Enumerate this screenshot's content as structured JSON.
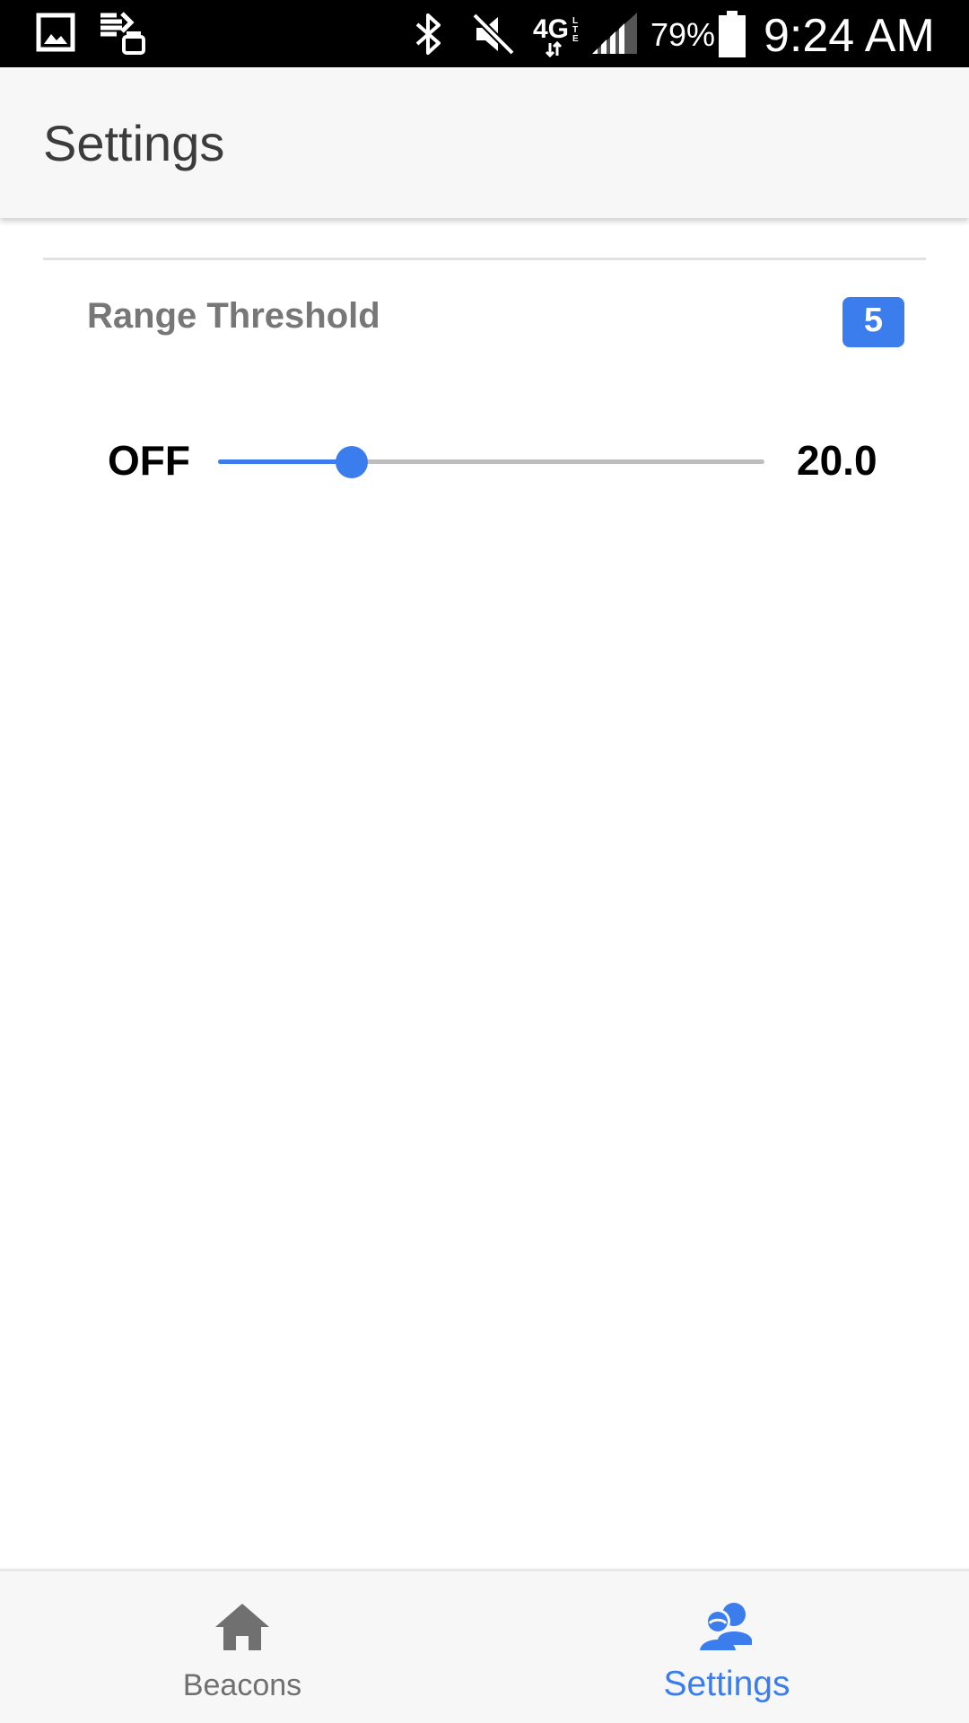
{
  "status_bar": {
    "battery_percent": "79%",
    "time": "9:24 AM",
    "icons": [
      "image-notification-icon",
      "cast-notification-icon",
      "bluetooth-icon",
      "mute-icon",
      "4g-lte-icon",
      "signal-icon",
      "battery-icon"
    ]
  },
  "header": {
    "title": "Settings"
  },
  "range_threshold": {
    "label": "Range Threshold",
    "badge_value": "5",
    "min_label": "OFF",
    "max_label": "20.0",
    "slider_fraction": 0.245,
    "accent_color": "#3b7ded"
  },
  "bottom_nav": {
    "items": [
      {
        "label": "Beacons",
        "icon": "home-icon",
        "active": false
      },
      {
        "label": "Settings",
        "icon": "people-icon",
        "active": true
      }
    ],
    "active_color": "#3b7ded",
    "inactive_color": "#707070"
  }
}
